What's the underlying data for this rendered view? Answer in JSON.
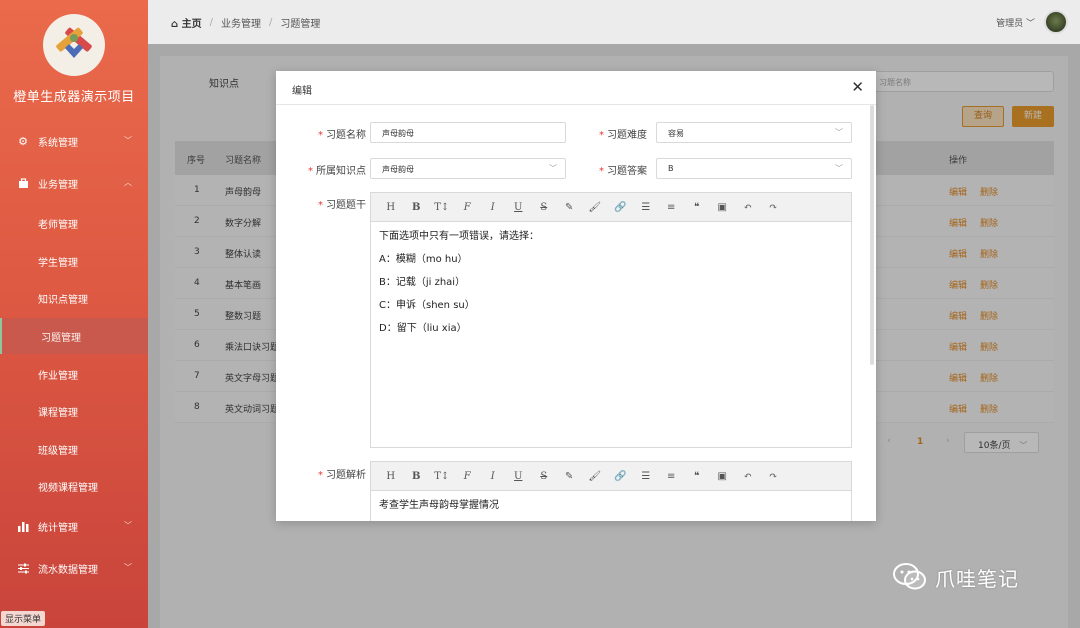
{
  "app": {
    "brand": "橙单生成器演示项目",
    "show_menu": "显示菜单"
  },
  "sidebar": {
    "groups": [
      {
        "label": "系统管理",
        "icon": "gear-icon"
      },
      {
        "label": "业务管理",
        "icon": "bag-icon"
      },
      {
        "label": "统计管理",
        "icon": "bar-chart-icon"
      },
      {
        "label": "流水数据管理",
        "icon": "sliders-icon"
      }
    ],
    "sub_items": [
      "老师管理",
      "学生管理",
      "知识点管理",
      "习题管理",
      "作业管理",
      "课程管理",
      "班级管理",
      "视频课程管理"
    ]
  },
  "header": {
    "breadcrumb": [
      "主页",
      "业务管理",
      "习题管理"
    ],
    "admin": "管理员"
  },
  "filters": {
    "knowledge_label": "知识点",
    "name_placeholder": "习题名称",
    "query_button": "查询",
    "new_button": "新建"
  },
  "table": {
    "headers": {
      "no": "序号",
      "name": "习题名称",
      "ops": "操作"
    },
    "rows": [
      {
        "no": "1",
        "name": "声母韵母",
        "edit": "编辑",
        "del": "删除"
      },
      {
        "no": "2",
        "name": "数字分解",
        "edit": "编辑",
        "del": "删除"
      },
      {
        "no": "3",
        "name": "整体认读",
        "edit": "编辑",
        "del": "删除"
      },
      {
        "no": "4",
        "name": "基本笔画",
        "edit": "编辑",
        "del": "删除"
      },
      {
        "no": "5",
        "name": "整数习题",
        "edit": "编辑",
        "del": "删除"
      },
      {
        "no": "6",
        "name": "乘法口诀习题",
        "edit": "编辑",
        "del": "删除"
      },
      {
        "no": "7",
        "name": "英文字母习题",
        "edit": "编辑",
        "del": "删除"
      },
      {
        "no": "8",
        "name": "英文动词习题",
        "edit": "编辑",
        "del": "删除"
      }
    ],
    "page": "1",
    "page_size": "10条/页"
  },
  "modal": {
    "title": "编辑",
    "fields": {
      "name_label": "习题名称",
      "name_value": "声母韵母",
      "difficulty_label": "习题难度",
      "difficulty_value": "容易",
      "knowledge_label": "所属知识点",
      "knowledge_value": "声母韵母",
      "answer_label": "习题答案",
      "answer_value": "B",
      "stem_label": "习题题干",
      "analysis_label": "习题解析"
    },
    "stem_lines": [
      "下面选项中只有一项错误，请选择：",
      "A：模糊（mo hu）",
      "B：记载（ji zhai）",
      "C：申诉（shen su）",
      "D：留下（liu xia）"
    ],
    "analysis_text": "考查学生声母韵母掌握情况",
    "toolbar": [
      {
        "glyph": "H",
        "icon": "heading-icon"
      },
      {
        "glyph": "B",
        "icon": "bold-icon"
      },
      {
        "glyph": "T↕",
        "icon": "font-size-icon"
      },
      {
        "glyph": "F",
        "icon": "font-family-icon"
      },
      {
        "glyph": "I",
        "icon": "italic-icon"
      },
      {
        "glyph": "U",
        "icon": "underline-icon"
      },
      {
        "glyph": "S",
        "icon": "strikethrough-icon"
      },
      {
        "glyph": "✎",
        "icon": "text-color-icon"
      },
      {
        "glyph": "🖌",
        "icon": "brush-icon"
      },
      {
        "glyph": "🔗",
        "icon": "link-icon"
      },
      {
        "glyph": "☰",
        "icon": "list-icon"
      },
      {
        "glyph": "≡",
        "icon": "align-icon"
      },
      {
        "glyph": "❝",
        "icon": "quote-icon"
      },
      {
        "glyph": "▣",
        "icon": "image-icon"
      },
      {
        "glyph": "↶",
        "icon": "undo-icon"
      },
      {
        "glyph": "↷",
        "icon": "redo-icon"
      }
    ]
  },
  "watermark": {
    "text": "爪哇笔记"
  },
  "colors": {
    "accent": "#e58b23",
    "sidebar": "#de5a43",
    "required": "#e53935"
  }
}
